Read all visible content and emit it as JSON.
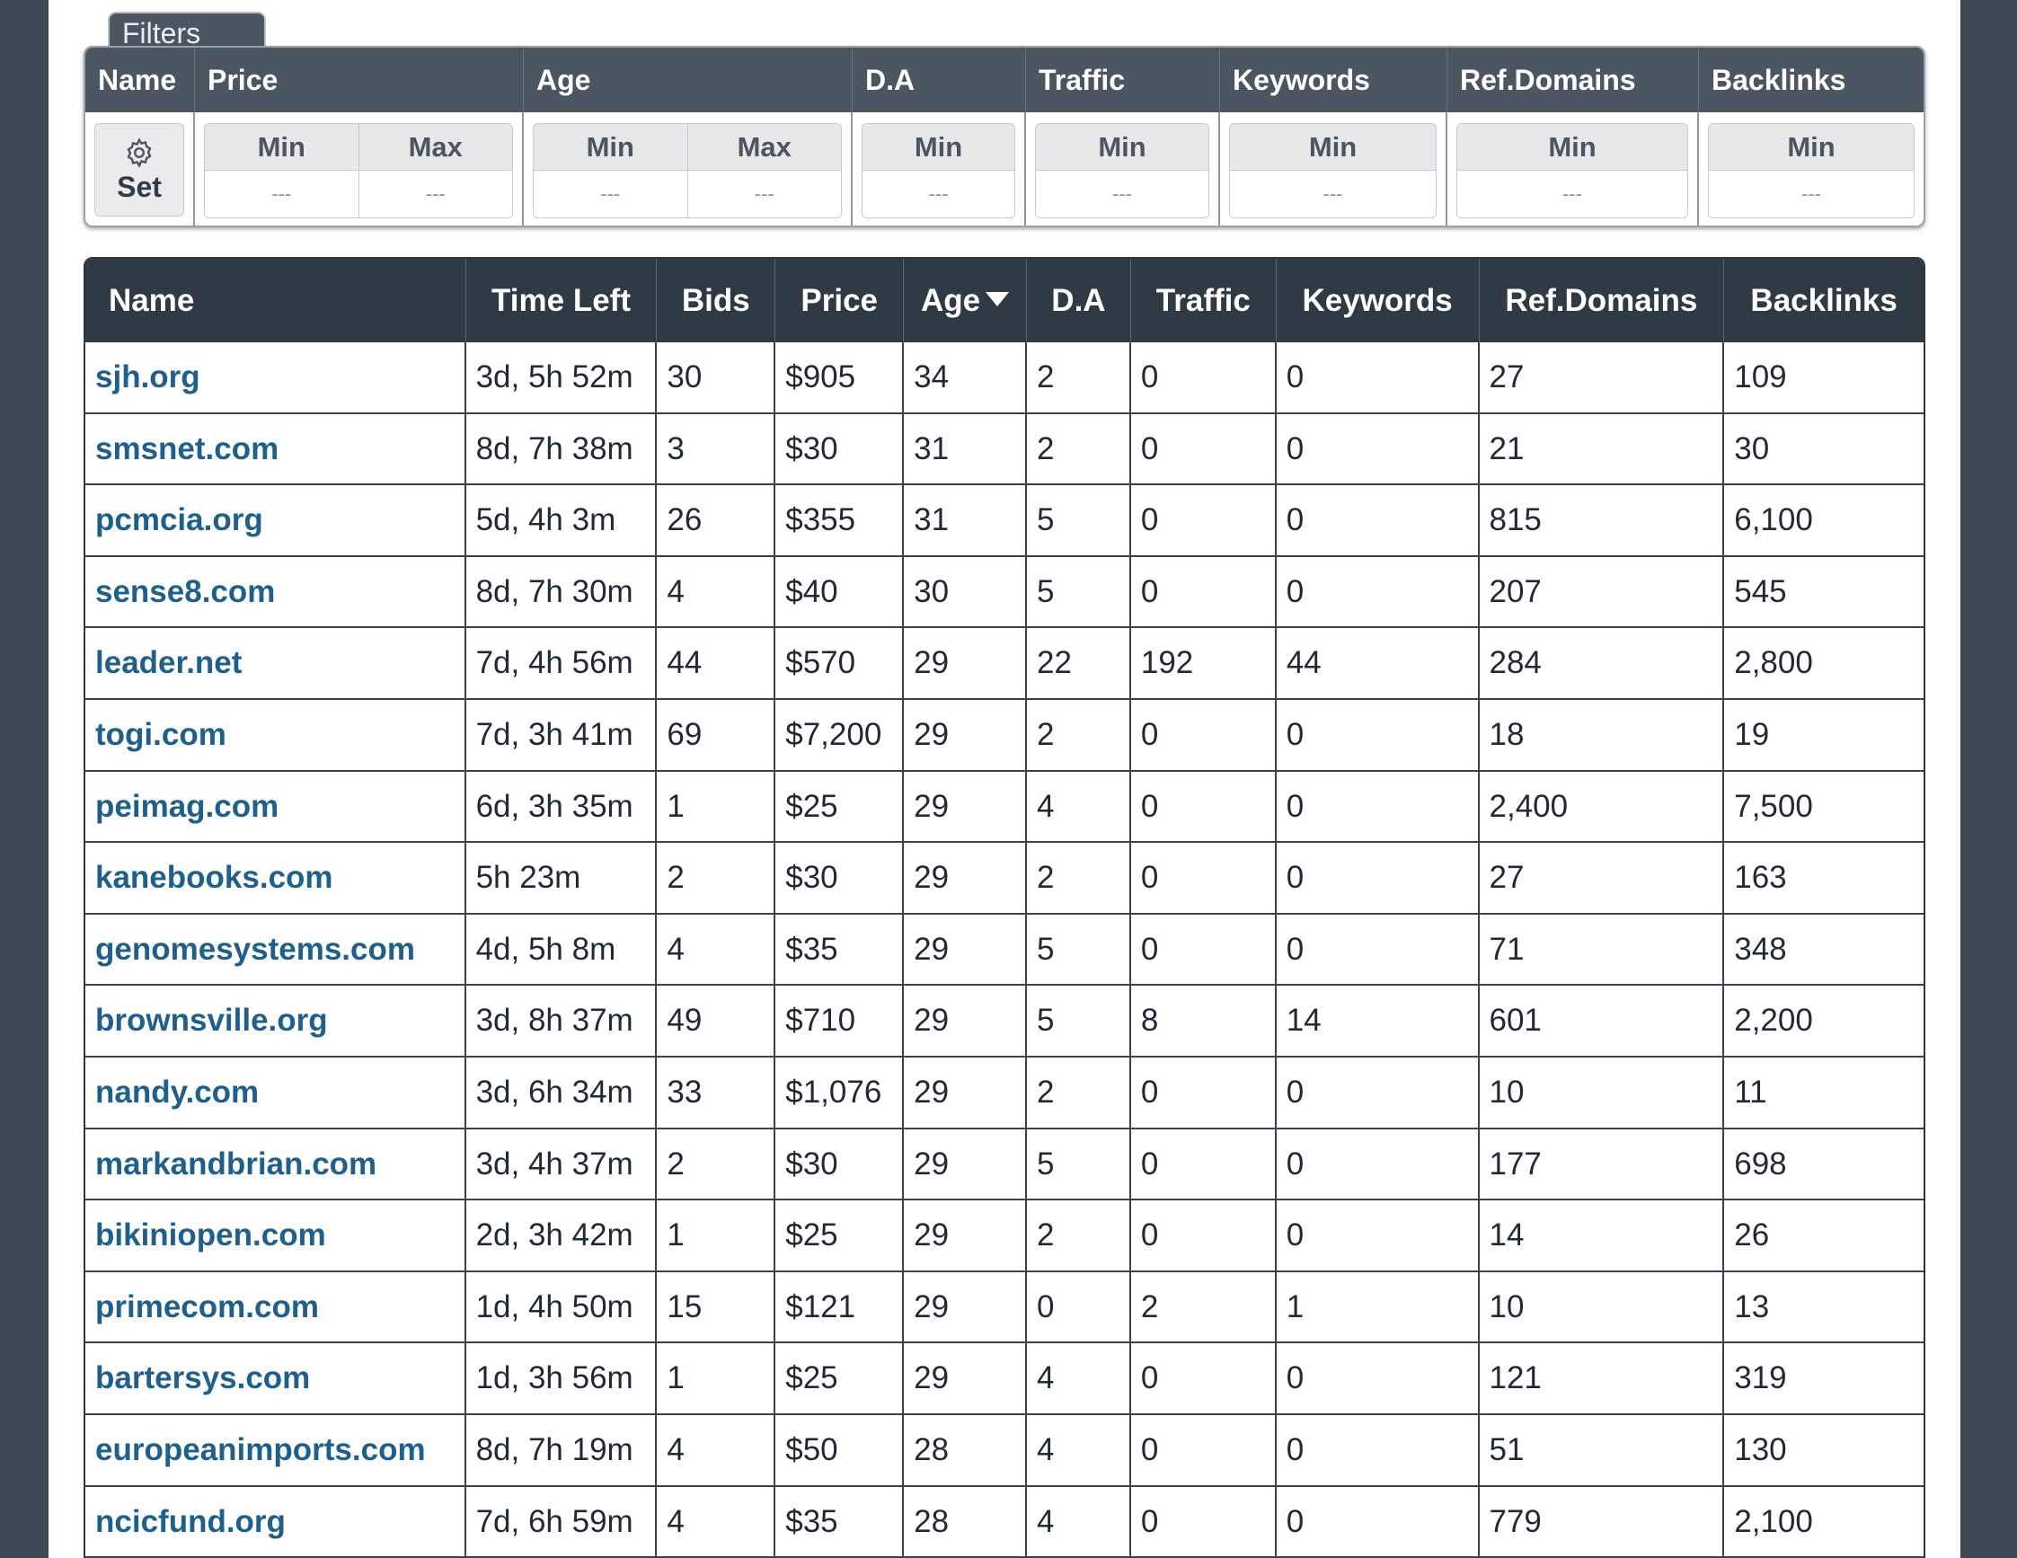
{
  "filters": {
    "tab_label": "Filters",
    "columns": {
      "name": "Name",
      "price": "Price",
      "age": "Age",
      "da": "D.A",
      "traffic": "Traffic",
      "keywords": "Keywords",
      "ref_domains": "Ref.Domains",
      "backlinks": "Backlinks"
    },
    "set_button_label": "Set",
    "min_label": "Min",
    "max_label": "Max",
    "empty_value": "---"
  },
  "results": {
    "headers": {
      "name": "Name",
      "time_left": "Time Left",
      "bids": "Bids",
      "price": "Price",
      "age": "Age",
      "da": "D.A",
      "traffic": "Traffic",
      "keywords": "Keywords",
      "ref_domains": "Ref.Domains",
      "backlinks": "Backlinks"
    },
    "sorted_by": "age",
    "sort_direction": "desc",
    "rows": [
      [
        "sjh.org",
        "3d, 5h 52m",
        "30",
        "$905",
        "34",
        "2",
        "0",
        "0",
        "27",
        "109"
      ],
      [
        "smsnet.com",
        "8d, 7h 38m",
        "3",
        "$30",
        "31",
        "2",
        "0",
        "0",
        "21",
        "30"
      ],
      [
        "pcmcia.org",
        "5d, 4h 3m",
        "26",
        "$355",
        "31",
        "5",
        "0",
        "0",
        "815",
        "6,100"
      ],
      [
        "sense8.com",
        "8d, 7h 30m",
        "4",
        "$40",
        "30",
        "5",
        "0",
        "0",
        "207",
        "545"
      ],
      [
        "leader.net",
        "7d, 4h 56m",
        "44",
        "$570",
        "29",
        "22",
        "192",
        "44",
        "284",
        "2,800"
      ],
      [
        "togi.com",
        "7d, 3h 41m",
        "69",
        "$7,200",
        "29",
        "2",
        "0",
        "0",
        "18",
        "19"
      ],
      [
        "peimag.com",
        "6d, 3h 35m",
        "1",
        "$25",
        "29",
        "4",
        "0",
        "0",
        "2,400",
        "7,500"
      ],
      [
        "kanebooks.com",
        "5h 23m",
        "2",
        "$30",
        "29",
        "2",
        "0",
        "0",
        "27",
        "163"
      ],
      [
        "genomesystems.com",
        "4d, 5h 8m",
        "4",
        "$35",
        "29",
        "5",
        "0",
        "0",
        "71",
        "348"
      ],
      [
        "brownsville.org",
        "3d, 8h 37m",
        "49",
        "$710",
        "29",
        "5",
        "8",
        "14",
        "601",
        "2,200"
      ],
      [
        "nandy.com",
        "3d, 6h 34m",
        "33",
        "$1,076",
        "29",
        "2",
        "0",
        "0",
        "10",
        "11"
      ],
      [
        "markandbrian.com",
        "3d, 4h 37m",
        "2",
        "$30",
        "29",
        "5",
        "0",
        "0",
        "177",
        "698"
      ],
      [
        "bikiniopen.com",
        "2d, 3h 42m",
        "1",
        "$25",
        "29",
        "2",
        "0",
        "0",
        "14",
        "26"
      ],
      [
        "primecom.com",
        "1d, 4h 50m",
        "15",
        "$121",
        "29",
        "0",
        "2",
        "1",
        "10",
        "13"
      ],
      [
        "bartersys.com",
        "1d, 3h 56m",
        "1",
        "$25",
        "29",
        "4",
        "0",
        "0",
        "121",
        "319"
      ],
      [
        "europeanimports.com",
        "8d, 7h 19m",
        "4",
        "$50",
        "28",
        "4",
        "0",
        "0",
        "51",
        "130"
      ],
      [
        "ncicfund.org",
        "7d, 6h 59m",
        "4",
        "$35",
        "28",
        "4",
        "0",
        "0",
        "779",
        "2,100"
      ]
    ]
  },
  "colors": {
    "background": "#3d4954",
    "header_dark": "#2f3a45",
    "filter_header": "#4b5661",
    "link": "#1f5f8b"
  },
  "icons": {
    "set": "gear-icon",
    "sort": "caret-down-icon"
  }
}
